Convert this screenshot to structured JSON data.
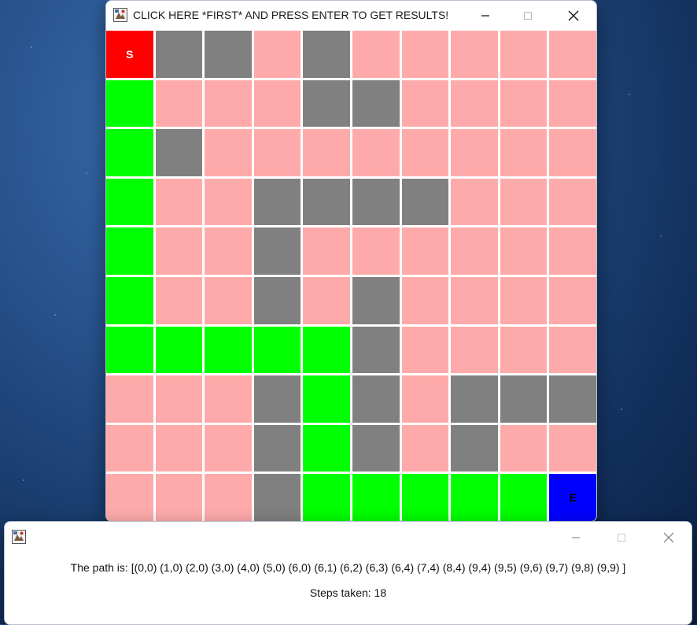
{
  "main_window": {
    "title": "CLICK HERE *FIRST* AND PRESS ENTER TO GET RESULTS!",
    "icon": "java-app-icon",
    "controls": [
      "minimize-icon",
      "maximize-icon",
      "close-icon"
    ]
  },
  "legend_colors": {
    "S": "#ff0000",
    "E": "#0000ff",
    "P": "#00ff00",
    "X": "#808080",
    ".": "#ffaaaa"
  },
  "grid": {
    "rows": 10,
    "cols": 10,
    "cells": [
      "SXX.X.....",
      "P...XX....",
      "PX........",
      "P..XXXX...",
      "P..X......",
      "P..X.X....",
      "PPPPPX....",
      "...XPX.XXX",
      "...XPX.X..",
      "...XPPPPPE"
    ],
    "start_label": "S",
    "end_label": "E"
  },
  "result_window": {
    "icon": "java-app-icon",
    "path_text": "The path is: [(0,0) (1,0) (2,0) (3,0) (4,0) (5,0) (6,0) (6,1) (6,2) (6,3) (6,4) (7,4) (8,4) (9,4) (9,5) (9,6) (9,7) (9,8) (9,9) ]",
    "steps_text": "Steps taken: 18"
  }
}
